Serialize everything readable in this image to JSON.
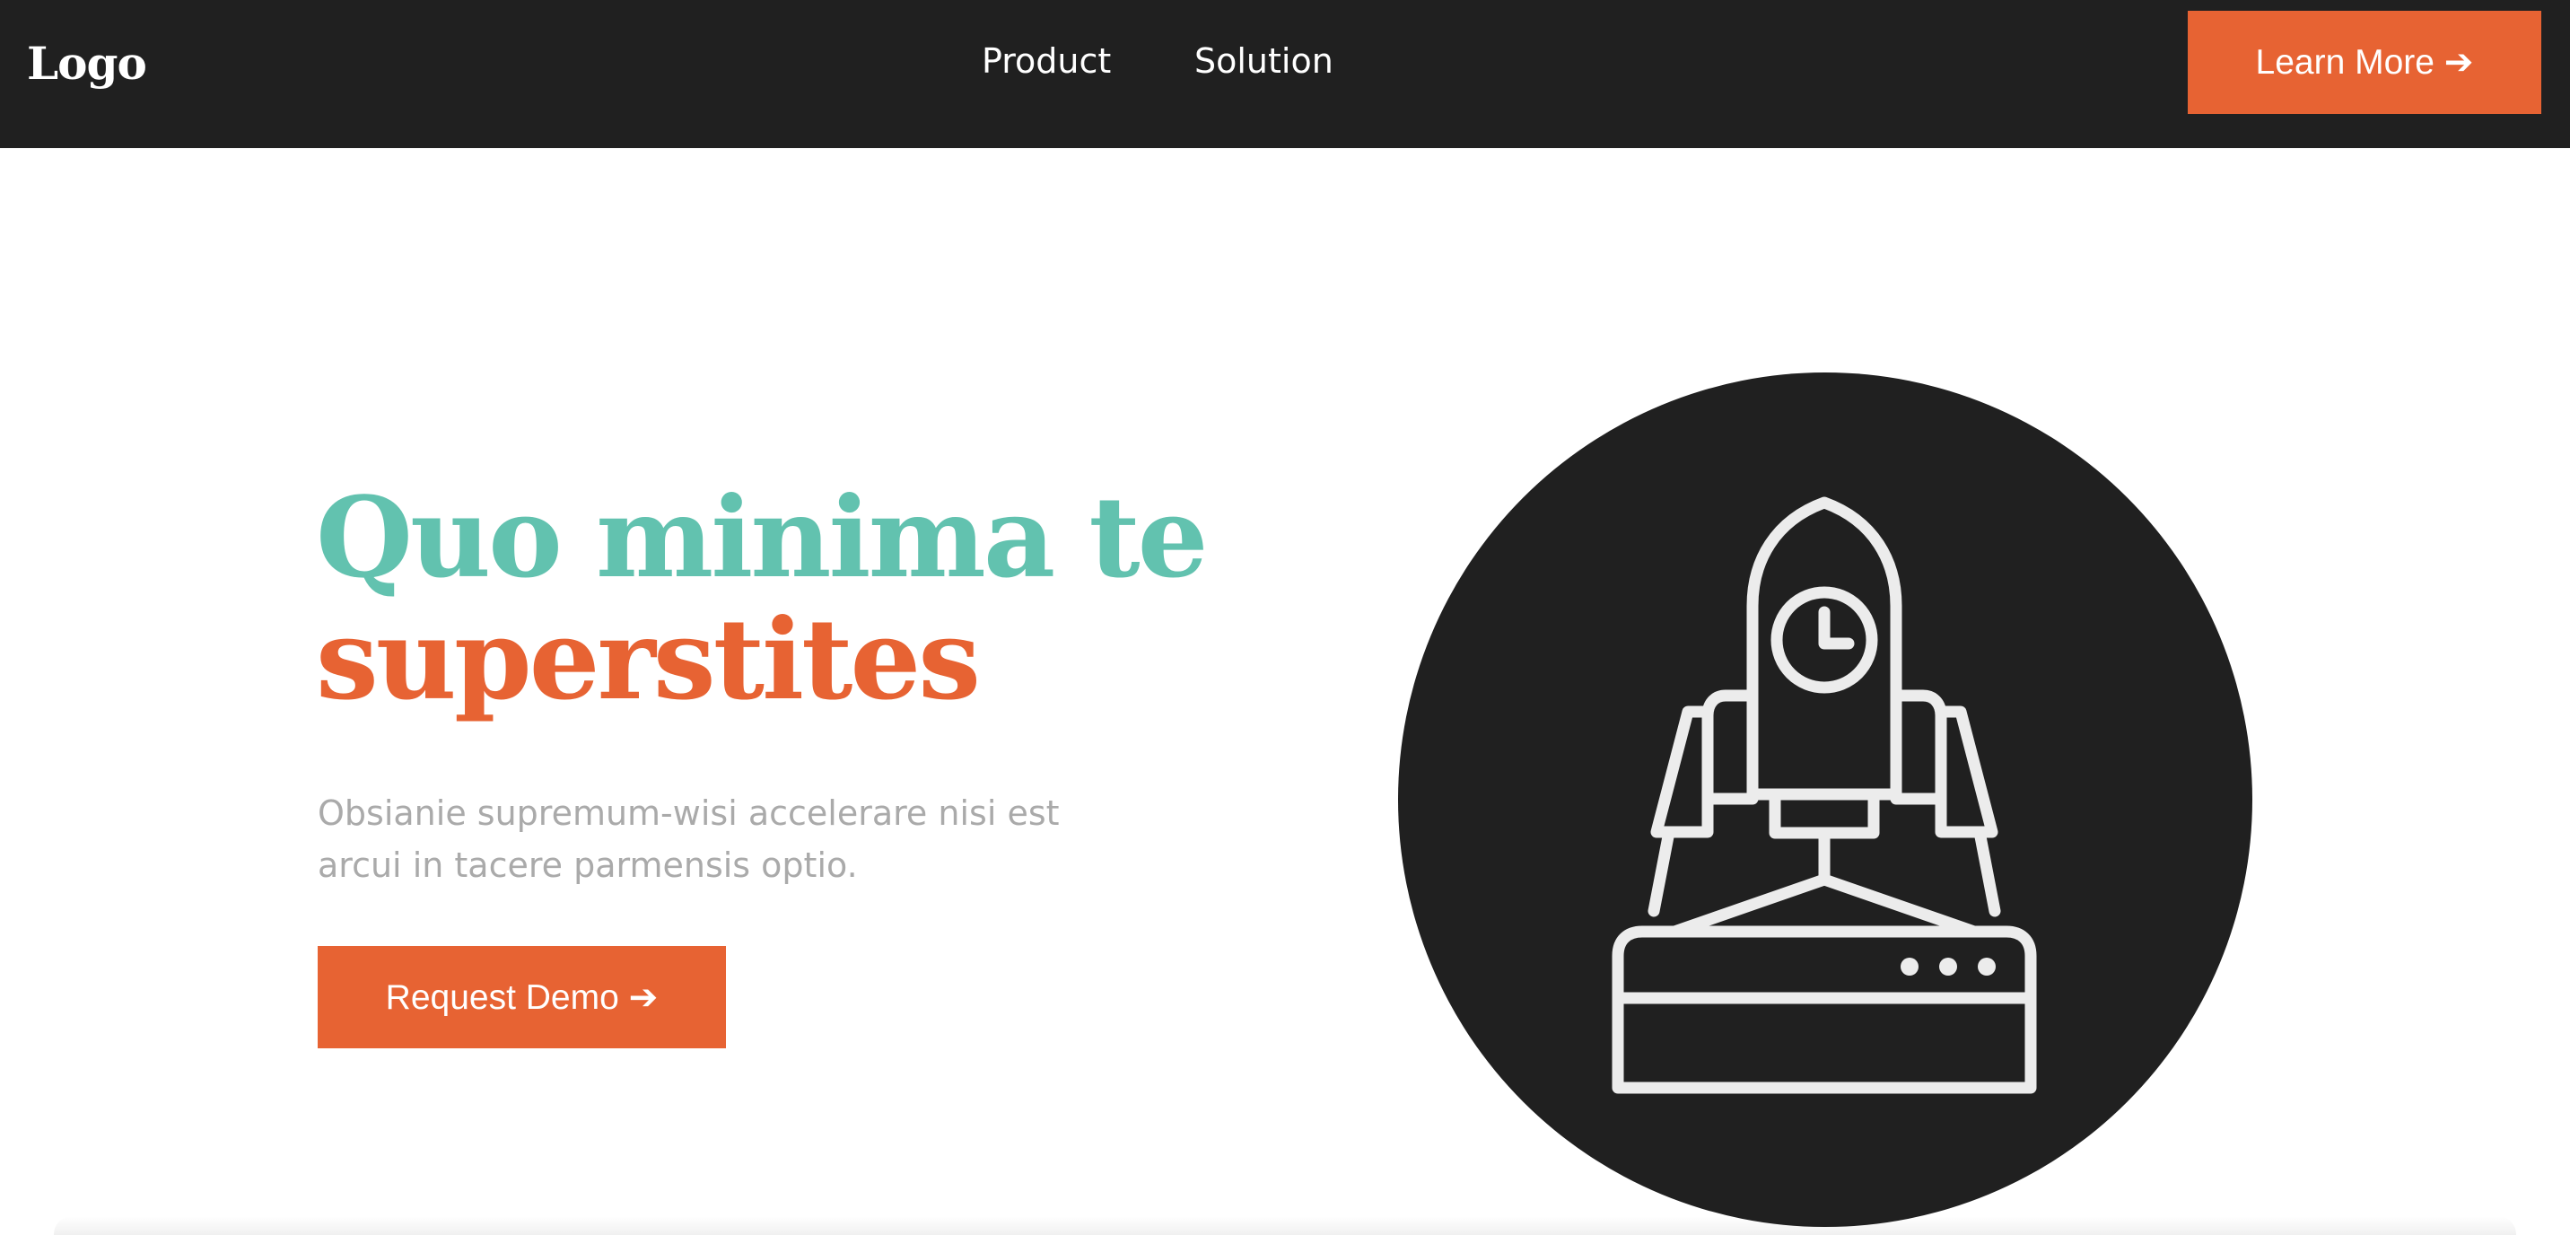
{
  "nav": {
    "logo": "Logo",
    "links": [
      "Product",
      "Solution"
    ],
    "cta_label": "Learn More ➔"
  },
  "hero": {
    "title_line1": "Quo minima te",
    "title_line2": "superstites",
    "subtitle": "Obsianie supremum-wisi accelerare nisi est arcui in tacere parmensis optio.",
    "cta_label": "Request Demo ➔",
    "illustration_icon": "rocket-launch-icon"
  },
  "colors": {
    "nav_bg": "#202020",
    "accent_orange": "#e76333",
    "accent_teal": "#62c2af",
    "subtitle_gray": "#aaaaaa"
  }
}
